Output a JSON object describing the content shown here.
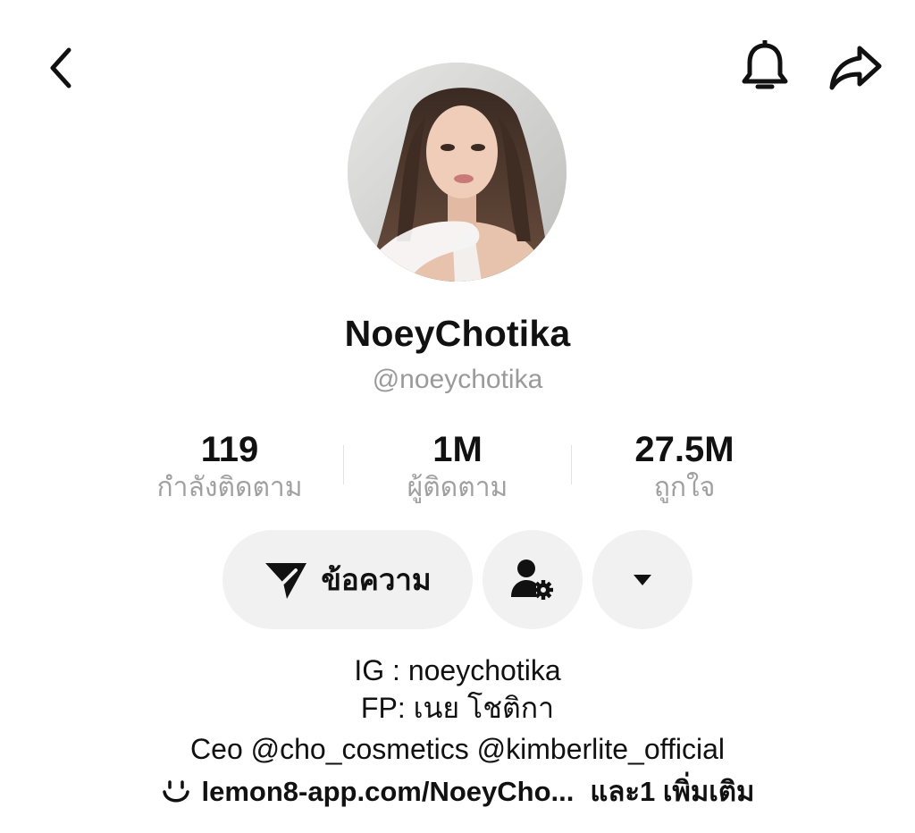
{
  "header": {
    "back_icon": "chevron-left-icon",
    "notification_icon": "bell-icon",
    "share_icon": "share-arrow-icon"
  },
  "profile": {
    "display_name": "NoeyChotika",
    "handle": "@noeychotika"
  },
  "stats": [
    {
      "value": "119",
      "label": "กำลังติดตาม"
    },
    {
      "value": "1M",
      "label": "ผู้ติดตาม"
    },
    {
      "value": "27.5M",
      "label": "ถูกใจ"
    }
  ],
  "actions": {
    "message_label": "ข้อความ",
    "message_icon": "send-icon",
    "follow_settings_icon": "user-settings-icon",
    "more_icon": "caret-down-icon"
  },
  "bio": {
    "lines": [
      "IG : noeychotika",
      "FP: เนย โชติกา",
      "Ceo @cho_cosmetics @kimberlite_official"
    ],
    "link_text": "lemon8-app.com/NoeyCho...",
    "link_more": "และ1 เพิ่มเติม",
    "link_icon": "smile-link-icon"
  }
}
